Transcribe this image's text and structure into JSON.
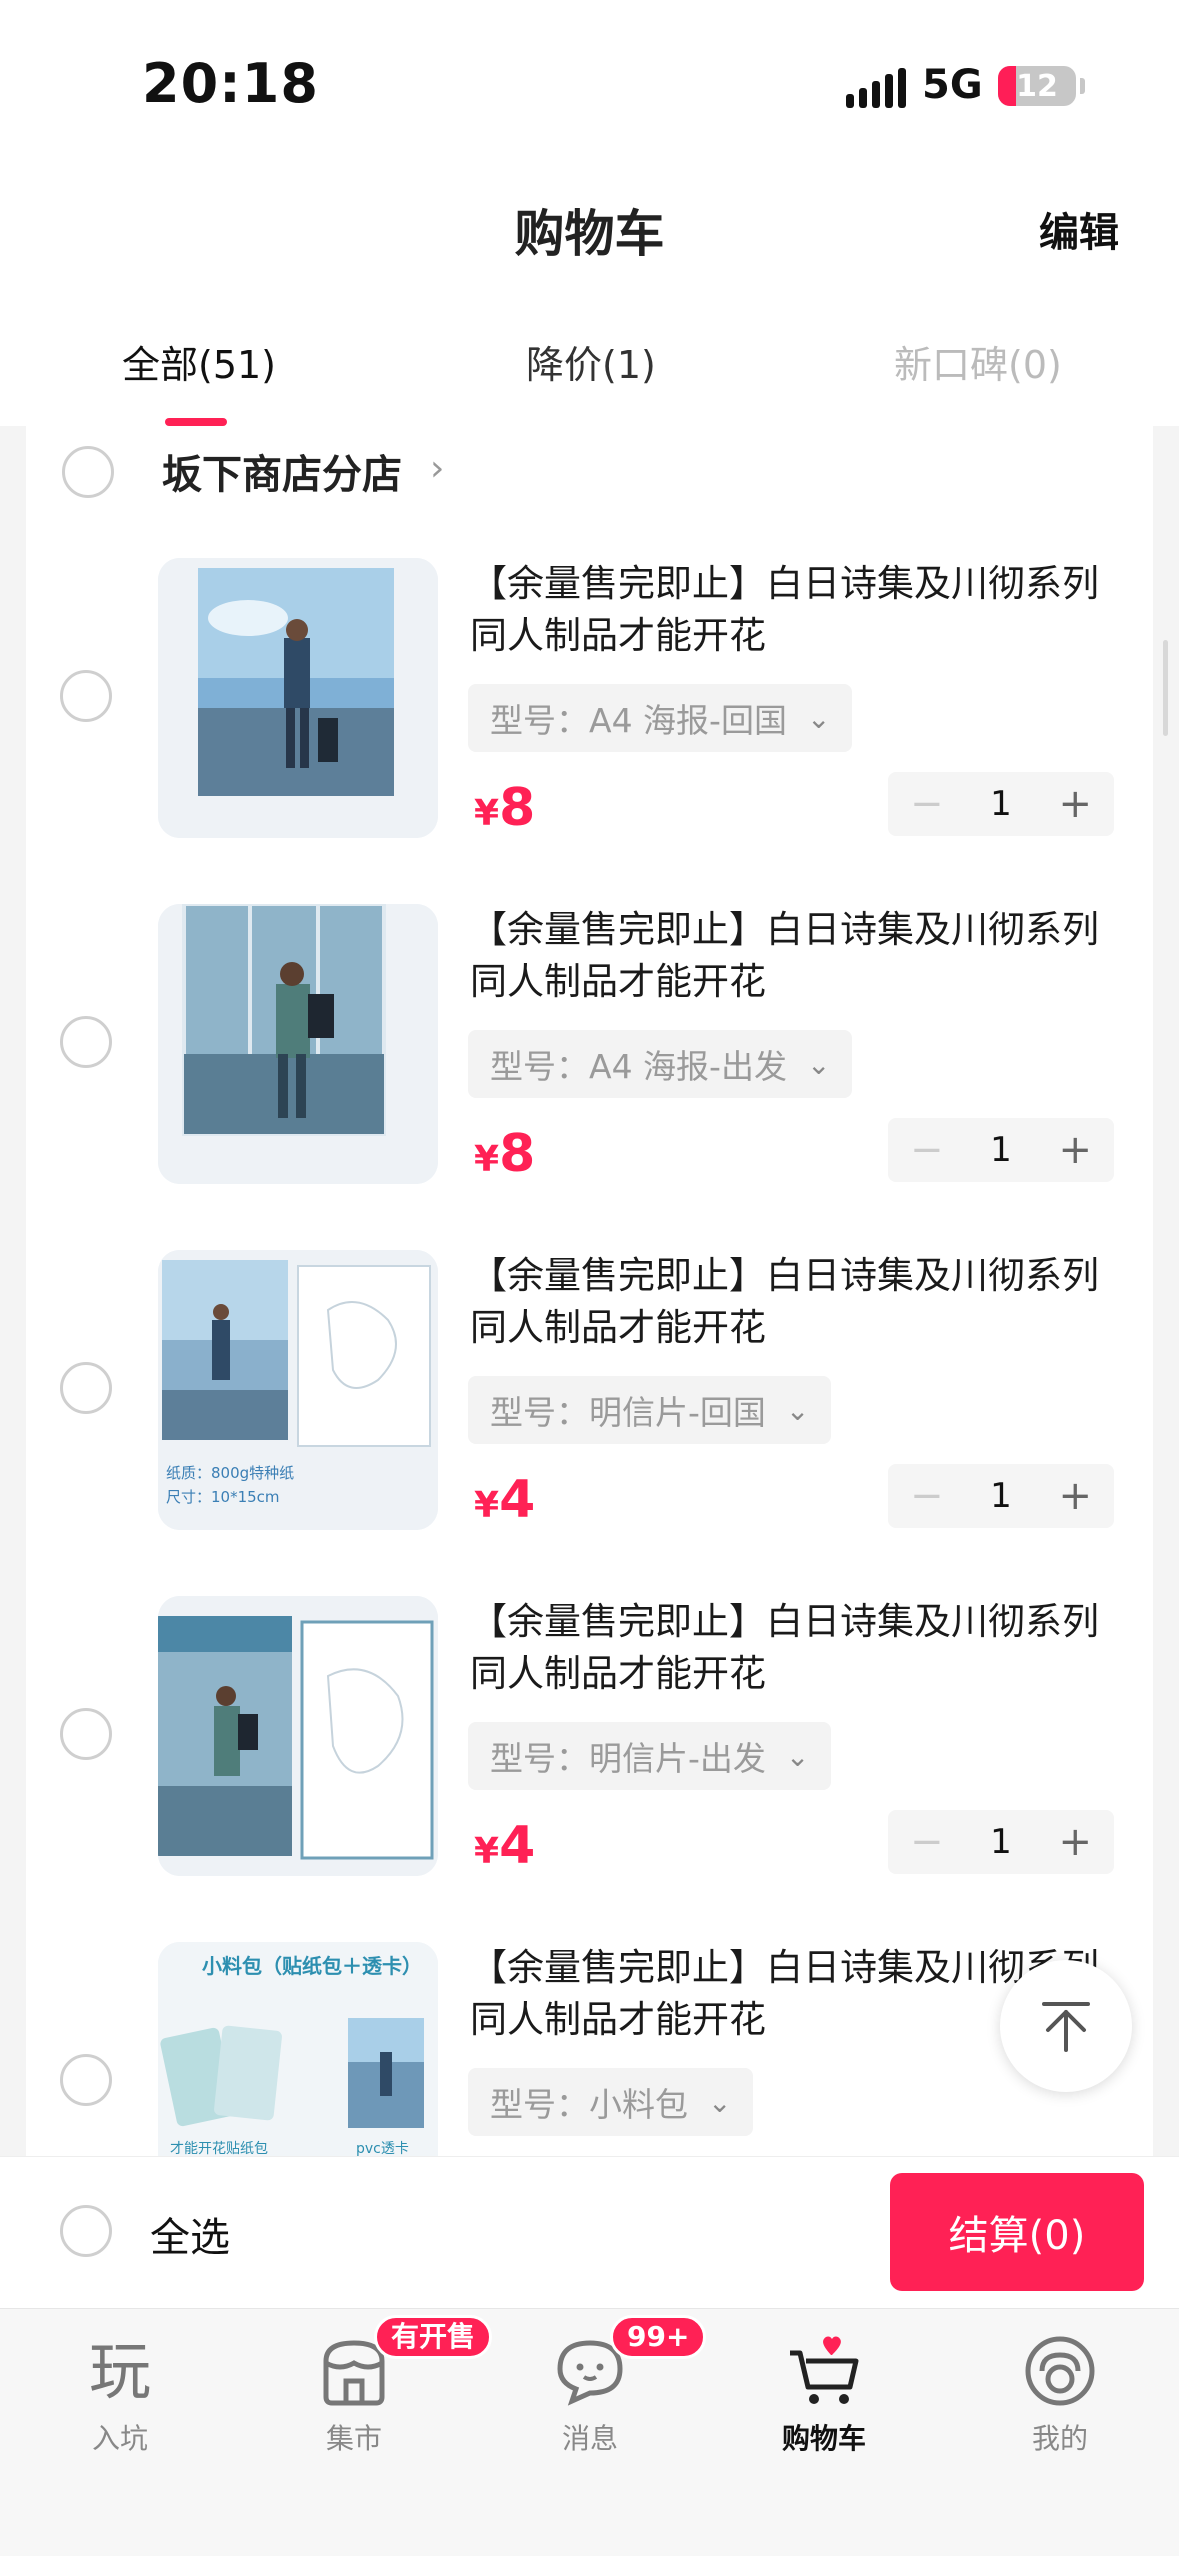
{
  "status_bar": {
    "time": "20:18",
    "network": "5G",
    "battery": "12"
  },
  "header": {
    "title": "购物车",
    "edit": "编辑"
  },
  "tabs": [
    {
      "label": "全部(51)"
    },
    {
      "label": "降价(1)"
    },
    {
      "label": "新口碑(0)"
    }
  ],
  "shop": {
    "name": "坂下商店分店"
  },
  "items": [
    {
      "title": "【余量售完即止】白日诗集及川彻系列同人制品才能开花",
      "variant": "型号：A4 海报-回国",
      "currency": "¥",
      "price": "8",
      "quantity": "1"
    },
    {
      "title": "【余量售完即止】白日诗集及川彻系列同人制品才能开花",
      "variant": "型号：A4 海报-出发",
      "currency": "¥",
      "price": "8",
      "quantity": "1"
    },
    {
      "title": "【余量售完即止】白日诗集及川彻系列同人制品才能开花",
      "variant": "型号：明信片-回国",
      "currency": "¥",
      "price": "4",
      "quantity": "1",
      "thumb_text": [
        "纸质：800g特种纸",
        "尺寸：10*15cm"
      ]
    },
    {
      "title": "【余量售完即止】白日诗集及川彻系列同人制品才能开花",
      "variant": "型号：明信片-出发",
      "currency": "¥",
      "price": "4",
      "quantity": "1"
    },
    {
      "title": "【余量售完即止】白日诗集及川彻系列同人制品才能开花",
      "variant": "型号：小料包",
      "thumb_text": [
        "小料包（贴纸包＋透卡）",
        "才能开花贴纸包",
        "pvc透卡"
      ]
    }
  ],
  "checkout": {
    "select_all": "全选",
    "button": "结算(0)"
  },
  "tabbar": [
    {
      "label": "入坑",
      "icon": "play-icon"
    },
    {
      "label": "集市",
      "icon": "market-icon",
      "badge": "有开售"
    },
    {
      "label": "消息",
      "icon": "message-icon",
      "badge": "99+"
    },
    {
      "label": "购物车",
      "icon": "cart-icon"
    },
    {
      "label": "我的",
      "icon": "profile-icon"
    }
  ],
  "colors": {
    "accent": "#ff2155"
  }
}
